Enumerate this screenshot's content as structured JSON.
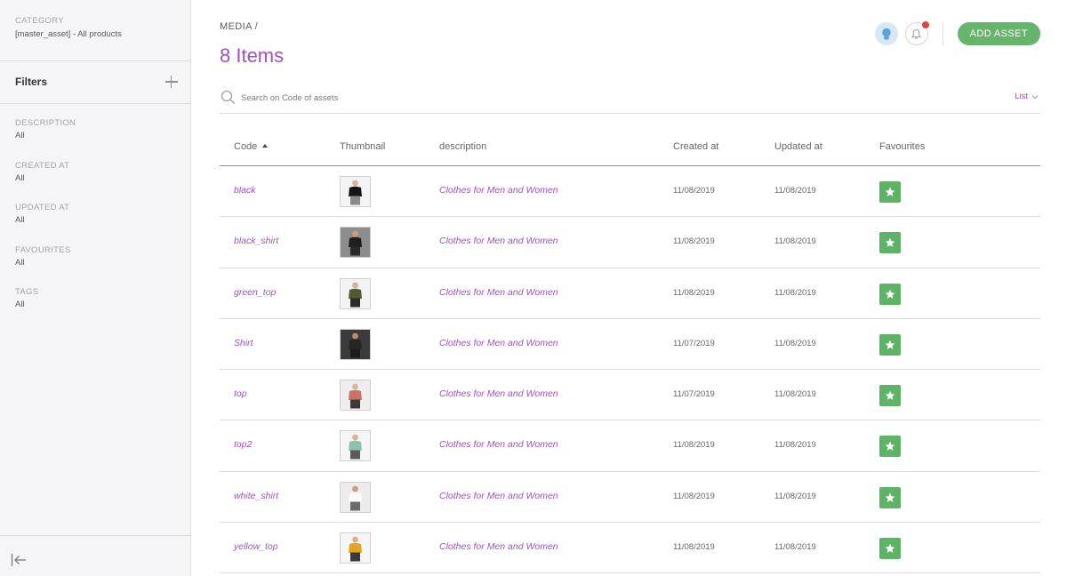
{
  "sidebar": {
    "category_label": "CATEGORY",
    "category_value": "[master_asset] - All products",
    "filters_title": "Filters",
    "filters": [
      {
        "label": "DESCRIPTION",
        "value": "All"
      },
      {
        "label": "CREATED AT",
        "value": "All"
      },
      {
        "label": "UPDATED AT",
        "value": "All"
      },
      {
        "label": "FAVOURITES",
        "value": "All"
      },
      {
        "label": "TAGS",
        "value": "All"
      }
    ]
  },
  "header": {
    "breadcrumb": "MEDIA /",
    "title": "8 Items",
    "add_button": "ADD ASSET"
  },
  "search": {
    "placeholder": "Search on Code of assets",
    "value": "",
    "view_mode": "List"
  },
  "table": {
    "columns": [
      "Code",
      "Thumbnail",
      "description",
      "Created at",
      "Updated at",
      "Favourites"
    ],
    "rows": [
      {
        "code": "black",
        "description": "Clothes for Men and Women",
        "created": "11/08/2019",
        "updated": "11/08/2019",
        "thumb": {
          "bg": "#f4f4f4",
          "cloth": "#151515",
          "skin": "#d8b49a",
          "legs": "#8a8a8a"
        }
      },
      {
        "code": "black_shirt",
        "description": "Clothes for Men and Women",
        "created": "11/08/2019",
        "updated": "11/08/2019",
        "thumb": {
          "bg": "#8d8d8d",
          "cloth": "#1e1e1e",
          "skin": "#c89d82",
          "legs": "#2a2a2a"
        }
      },
      {
        "code": "green_top",
        "description": "Clothes for Men and Women",
        "created": "11/08/2019",
        "updated": "11/08/2019",
        "thumb": {
          "bg": "#f3f3f3",
          "cloth": "#4f5b33",
          "skin": "#d5b197",
          "legs": "#2b2b2b"
        }
      },
      {
        "code": "Shirt",
        "description": "Clothes for Men and Women",
        "created": "11/07/2019",
        "updated": "11/08/2019",
        "thumb": {
          "bg": "#3b3b3b",
          "cloth": "#262626",
          "skin": "#b98f73",
          "legs": "#1d1d1d"
        }
      },
      {
        "code": "top",
        "description": "Clothes for Men and Women",
        "created": "11/07/2019",
        "updated": "11/08/2019",
        "thumb": {
          "bg": "#eeeeee",
          "cloth": "#c8726e",
          "skin": "#d9b59b",
          "legs": "#3a3a3a"
        }
      },
      {
        "code": "top2",
        "description": "Clothes for Men and Women",
        "created": "11/08/2019",
        "updated": "11/08/2019",
        "thumb": {
          "bg": "#f5f5f5",
          "cloth": "#8fc1b0",
          "skin": "#d7b398",
          "legs": "#5a5a5a"
        }
      },
      {
        "code": "white_shirt",
        "description": "Clothes for Men and Women",
        "created": "11/08/2019",
        "updated": "11/08/2019",
        "thumb": {
          "bg": "#ececec",
          "cloth": "#fbfbfb",
          "skin": "#c99f84",
          "legs": "#6b6b6b"
        }
      },
      {
        "code": "yellow_top",
        "description": "Clothes for Men and Women",
        "created": "11/08/2019",
        "updated": "11/08/2019",
        "thumb": {
          "bg": "#f6f6f6",
          "cloth": "#e3a521",
          "skin": "#d5b095",
          "legs": "#3a3a3a"
        }
      }
    ]
  },
  "icons": {
    "filters_add": "plus-icon",
    "collapse": "collapse-sidebar-icon",
    "search": "search-icon",
    "notifications": "bell-icon",
    "favourite": "star-icon",
    "view_switch": "chevron-down-icon"
  },
  "colors": {
    "accent": "#a24fc5",
    "primary_button": "#67b56d",
    "favourite": "#5fb366",
    "notification_dot": "#e0463f"
  }
}
